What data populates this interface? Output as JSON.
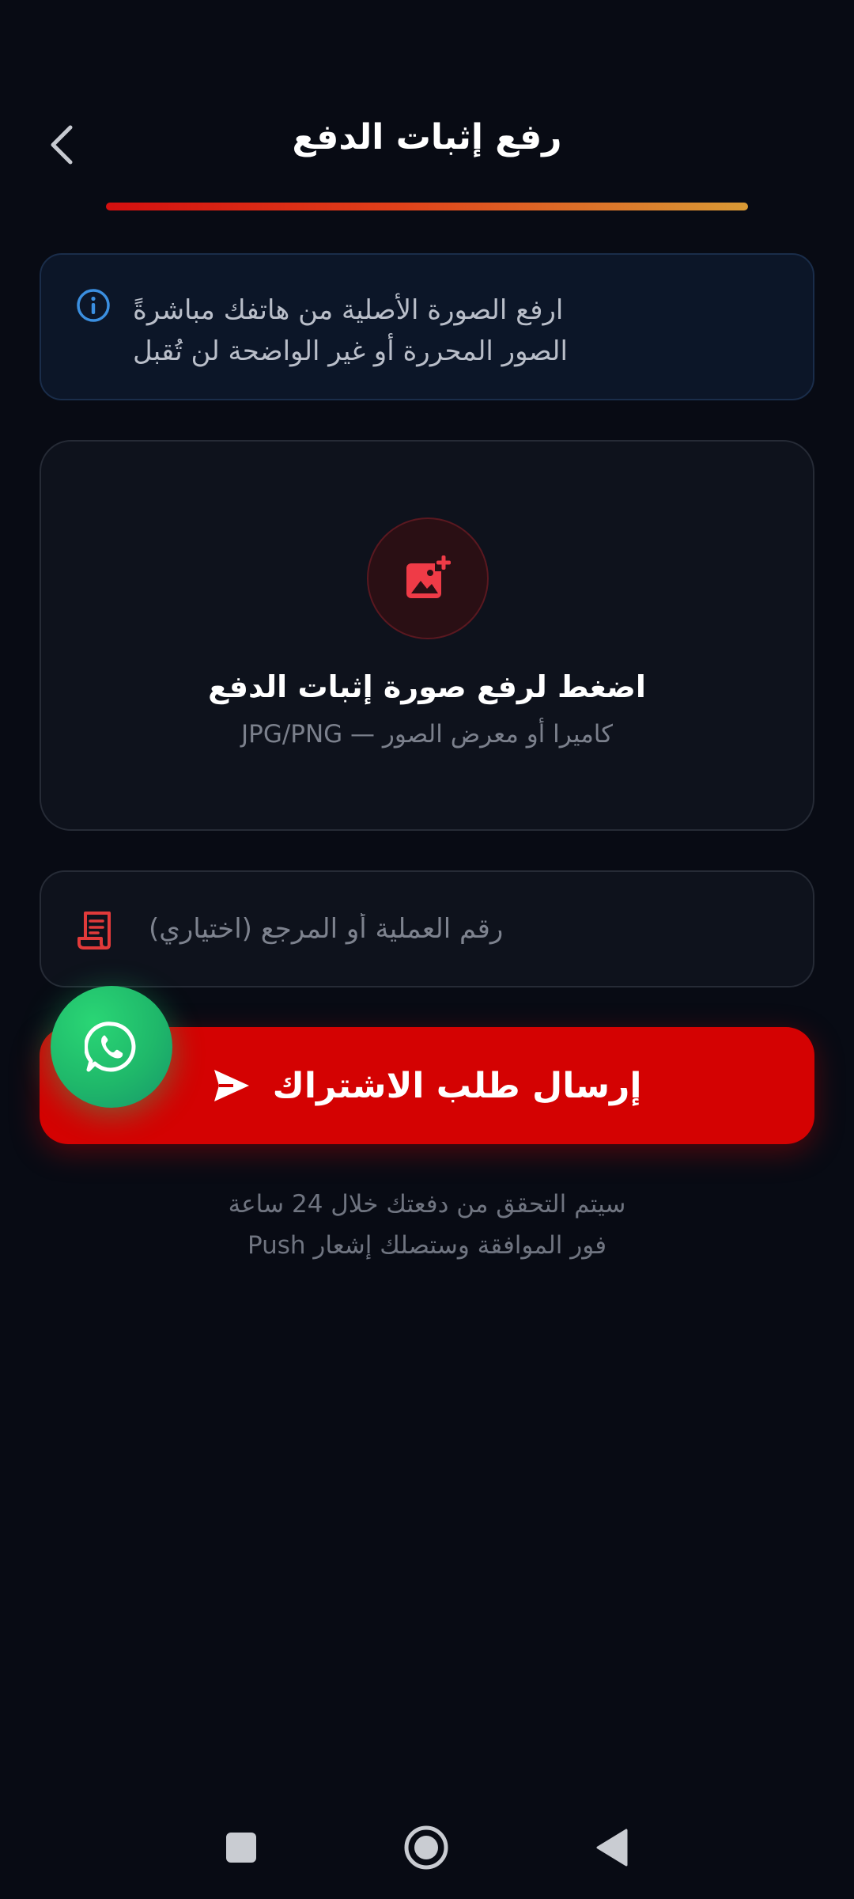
{
  "header": {
    "title": "رفع إثبات الدفع",
    "back_icon": "chevron-left-icon"
  },
  "progress": {
    "value": 1.0,
    "colors": [
      "#d40f0f",
      "#d99a35"
    ]
  },
  "info": {
    "icon": "info-icon",
    "line1": "ارفع الصورة الأصلية من هاتفك مباشرةً",
    "line2": "الصور المحررة أو غير الواضحة لن تُقبل"
  },
  "upload": {
    "icon": "add-photo-icon",
    "title": "اضغط لرفع صورة إثبات الدفع",
    "subtitle": "كاميرا أو معرض الصور — JPG/PNG"
  },
  "reference": {
    "icon": "receipt-icon",
    "placeholder": "رقم العملية أو المرجع (اختياري)",
    "value": ""
  },
  "submit": {
    "label": "إرسال طلب الاشتراك",
    "icon": "send-icon"
  },
  "whatsapp": {
    "icon": "whatsapp-icon"
  },
  "note": {
    "line1": "سيتم التحقق من دفعتك خلال 24 ساعة",
    "line2": "فور الموافقة وستصلك إشعار Push"
  },
  "navbar": {
    "recents_icon": "square-icon",
    "home_icon": "circle-home-icon",
    "back_icon": "triangle-back-icon"
  },
  "colors": {
    "accent": "#d40202",
    "background": "#080b14",
    "info_blue": "#3b8fe0",
    "whatsapp_green": "#1fb86a"
  }
}
